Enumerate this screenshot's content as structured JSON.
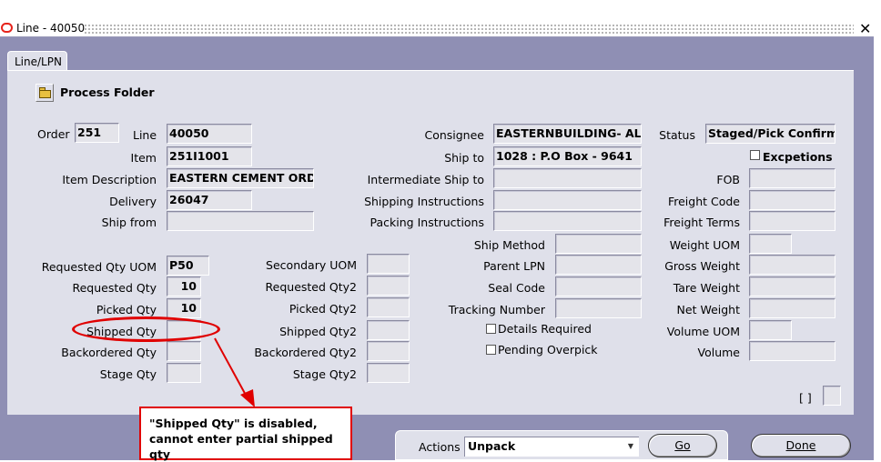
{
  "window": {
    "title": "Line - 40050",
    "close_glyph": "✕"
  },
  "tab": {
    "label": "Line/LPN"
  },
  "process_folder": {
    "label": "Process Folder",
    "icon": "folder-icon"
  },
  "left": {
    "order_label": "Order",
    "order_value": "251",
    "line_label": "Line",
    "line_value": "40050",
    "item_label": "Item",
    "item_value": "251I1001",
    "item_description_label": "Item Description",
    "item_description_value": "EASTERN CEMENT ORDIN",
    "delivery_label": "Delivery",
    "delivery_value": "26047",
    "ship_from_label": "Ship from",
    "ship_from_value": ""
  },
  "quantities": {
    "requested_qty_uom_label": "Requested Qty UOM",
    "requested_qty_uom_value": "P50",
    "requested_qty_label": "Requested Qty",
    "requested_qty_value": "10",
    "picked_qty_label": "Picked Qty",
    "picked_qty_value": "10",
    "shipped_qty_label": "Shipped Qty",
    "shipped_qty_value": "",
    "backordered_qty_label": "Backordered Qty",
    "backordered_qty_value": "",
    "stage_qty_label": "Stage Qty",
    "stage_qty_value": ""
  },
  "secondary": {
    "secondary_uom_label": "Secondary UOM",
    "requested_qty2_label": "Requested Qty2",
    "picked_qty2_label": "Picked Qty2",
    "shipped_qty2_label": "Shipped Qty2",
    "backordered_qty2_label": "Backordered Qty2",
    "stage_qty2_label": "Stage Qty2"
  },
  "middle": {
    "consignee_label": "Consignee",
    "consignee_value": "EASTERNBUILDING- ALL",
    "ship_to_label": "Ship to",
    "ship_to_value": "1028 : P.O Box - 9641",
    "intermediate_ship_to_label": "Intermediate Ship to",
    "shipping_instructions_label": "Shipping Instructions",
    "packing_instructions_label": "Packing Instructions",
    "ship_method_label": "Ship Method",
    "parent_lpn_label": "Parent LPN",
    "seal_code_label": "Seal Code",
    "tracking_number_label": "Tracking Number",
    "details_required_label": "Details Required",
    "pending_overpick_label": "Pending Overpick"
  },
  "right": {
    "status_label": "Status",
    "status_value": "Staged/Pick Confirme",
    "exceptions_label": "Excpetions",
    "fob_label": "FOB",
    "freight_code_label": "Freight Code",
    "freight_terms_label": "Freight Terms",
    "weight_uom_label": "Weight UOM",
    "gross_weight_label": "Gross Weight",
    "tare_weight_label": "Tare Weight",
    "net_weight_label": "Net Weight",
    "volume_uom_label": "Volume UOM",
    "volume_label": "Volume",
    "brackets_label": "[ ]"
  },
  "annotation": {
    "line1": "\"Shipped Qty\" is disabled,",
    "line2": "cannot enter partial shipped qty"
  },
  "footer": {
    "actions_label": "Actions",
    "actions_value": "Unpack",
    "go_label": "Go",
    "done_label": "Done"
  },
  "colors": {
    "annotation": "#e00000",
    "window_bg": "#8f8fb4",
    "panel_bg": "#dfe0ea"
  }
}
